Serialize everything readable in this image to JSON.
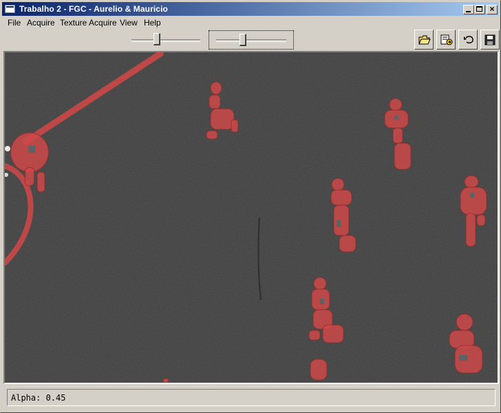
{
  "window": {
    "title": "Trabalho 2 - FGC - Aurelio & Mauricio",
    "caption_buttons": [
      "minimize",
      "maximize",
      "close"
    ],
    "close_glyph": "×"
  },
  "menu": {
    "items": [
      "File",
      "Acquire",
      "Texture Acquire",
      "View",
      "Help"
    ]
  },
  "toolbar": {
    "sliders": [
      {
        "name": "slider-1",
        "value": 0.4
      },
      {
        "name": "slider-2",
        "value": 0.42
      }
    ],
    "buttons": [
      {
        "name": "open-folder-icon"
      },
      {
        "name": "export-icon"
      },
      {
        "name": "undo-icon"
      },
      {
        "name": "save-icon"
      }
    ]
  },
  "viewport": {
    "description_colors": {
      "field": "#3b3b3b",
      "overlay": "#e04a4a"
    }
  },
  "status": {
    "text": "Alpha: 0.45"
  }
}
